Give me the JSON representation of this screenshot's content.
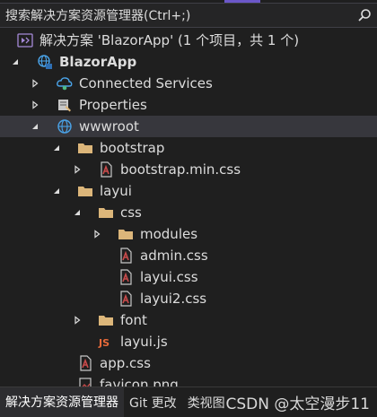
{
  "search": {
    "placeholder": "搜索解决方案资源管理器(Ctrl+;)"
  },
  "tree": {
    "solution": "解决方案 'BlazorApp' (1 个项目，共 1 个)",
    "project": "BlazorApp",
    "connected_services": "Connected Services",
    "properties": "Properties",
    "wwwroot": "wwwroot",
    "bootstrap": "bootstrap",
    "bootstrap_min_css": "bootstrap.min.css",
    "layui": "layui",
    "css": "css",
    "modules": "modules",
    "admin_css": "admin.css",
    "layui_css": "layui.css",
    "layui2_css": "layui2.css",
    "font": "font",
    "layui_js": "layui.js",
    "app_css": "app.css",
    "favicon": "favicon.png"
  },
  "tabs": {
    "solution_explorer": "解决方案资源管理器",
    "git_changes": "Git 更改",
    "other": "类视图"
  },
  "watermark": "CSDN @太空漫步11",
  "colors": {
    "background": "#1f1f1f",
    "selection": "#37373d",
    "folder": "#dcb67a",
    "accent": "#6b57c9",
    "css_file": "#c94b4b",
    "js_label": "#e86a3a"
  }
}
